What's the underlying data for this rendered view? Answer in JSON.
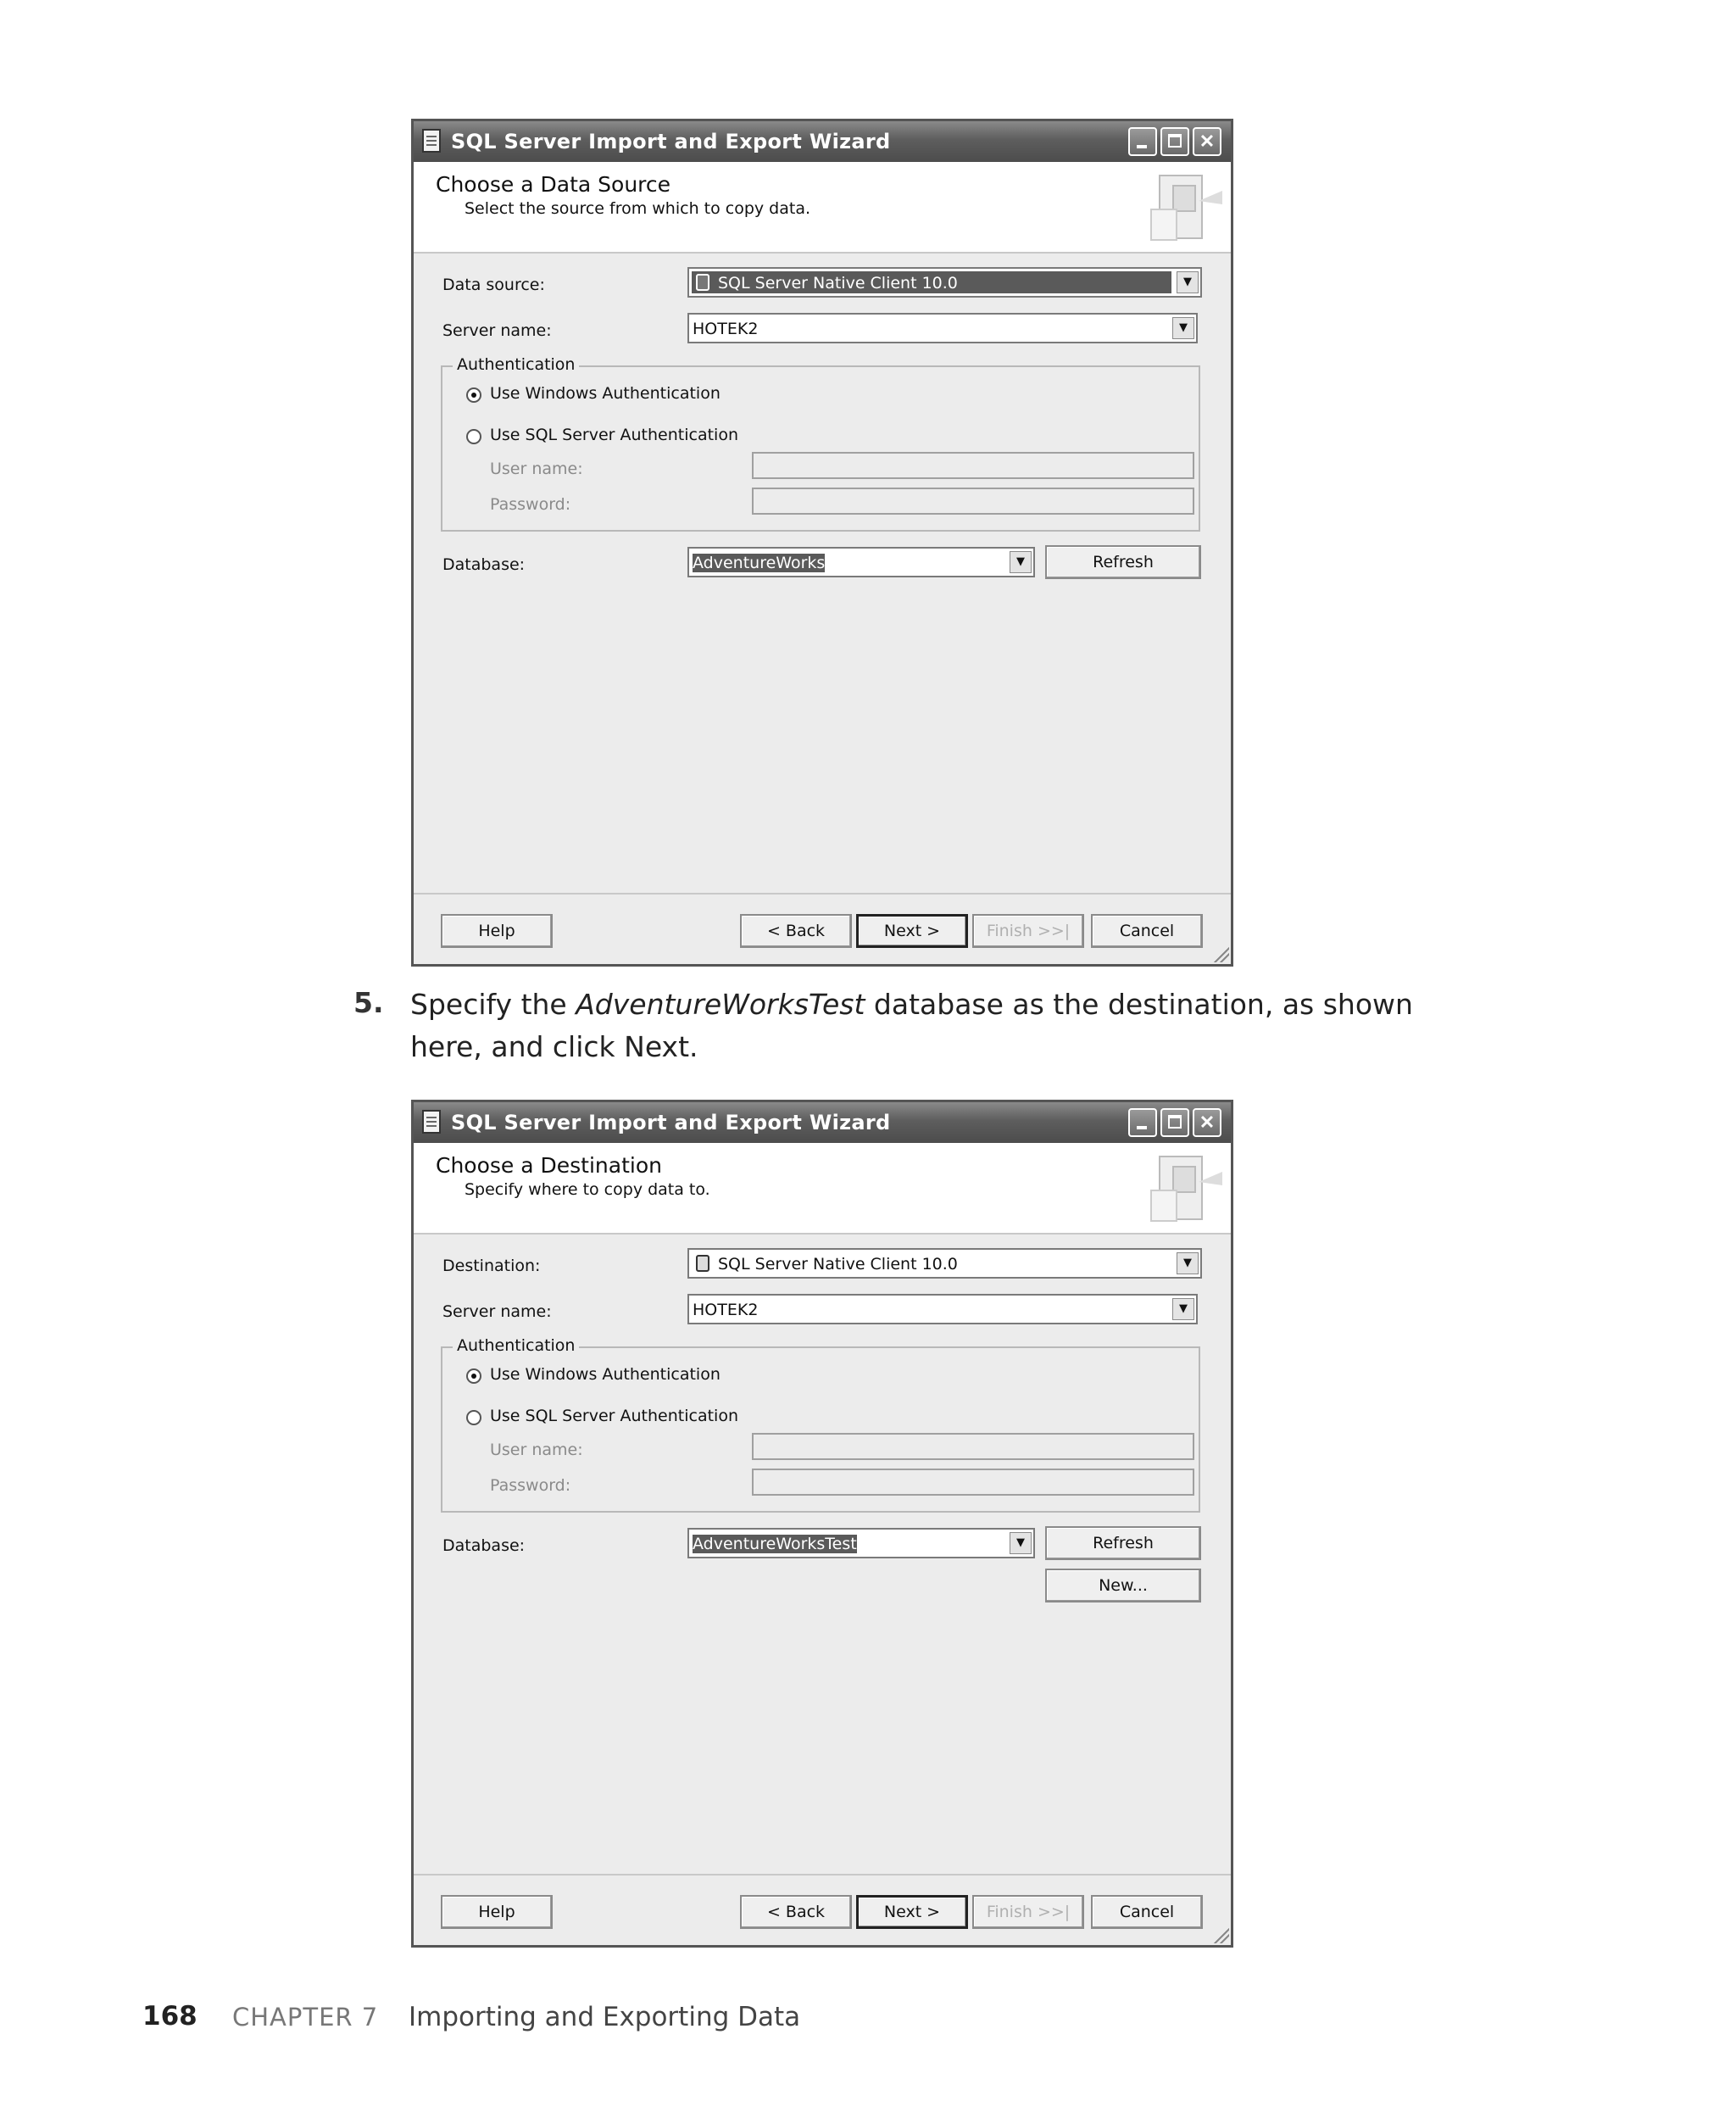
{
  "dialog1": {
    "title": "SQL Server Import and Export Wizard",
    "header_title": "Choose a Data Source",
    "header_subtitle": "Select the source from which to copy data.",
    "source_label": "Data source:",
    "source_value": "SQL Server Native Client 10.0",
    "server_label": "Server name:",
    "server_value": "HOTEK2",
    "auth_legend": "Authentication",
    "windows_auth": "Use Windows Authentication",
    "sql_auth": "Use SQL Server Authentication",
    "username_label": "User name:",
    "password_label": "Password:",
    "database_label": "Database:",
    "database_value": "AdventureWorks",
    "refresh": "Refresh",
    "help": "Help",
    "back": "< Back",
    "next": "Next >",
    "finish": "Finish >>|",
    "cancel": "Cancel"
  },
  "instruction": {
    "number": "5.",
    "text_before": "Specify the ",
    "emphasis": "AdventureWorksTest",
    "text_after": " database as the destination, as shown here, and click Next."
  },
  "dialog2": {
    "title": "SQL Server Import and Export Wizard",
    "header_title": "Choose a Destination",
    "header_subtitle": "Specify where to copy data to.",
    "destination_label": "Destination:",
    "destination_value": "SQL Server Native Client 10.0",
    "server_label": "Server name:",
    "server_value": "HOTEK2",
    "auth_legend": "Authentication",
    "windows_auth": "Use Windows Authentication",
    "sql_auth": "Use SQL Server Authentication",
    "username_label": "User name:",
    "password_label": "Password:",
    "database_label": "Database:",
    "database_value": "AdventureWorksTest",
    "refresh": "Refresh",
    "new": "New...",
    "help": "Help",
    "back": "< Back",
    "next": "Next >",
    "finish": "Finish >>|",
    "cancel": "Cancel"
  },
  "footer": {
    "page_number": "168",
    "chapter": "CHAPTER 7",
    "title": "Importing and Exporting Data"
  }
}
